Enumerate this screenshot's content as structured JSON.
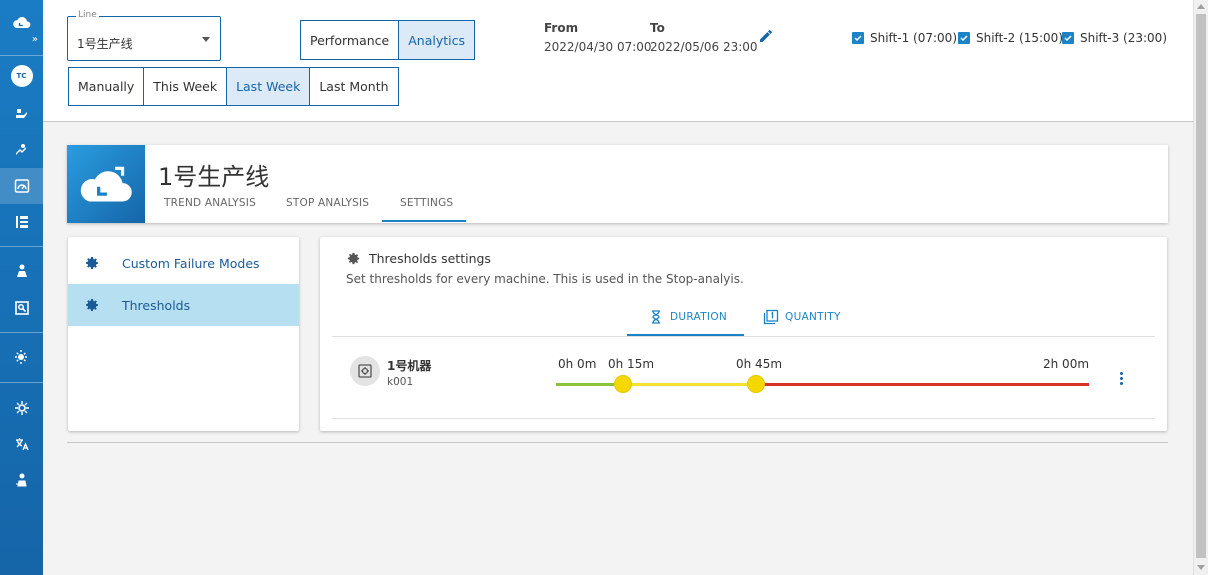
{
  "sidenav": {
    "avatar": "TC",
    "icons": [
      "cloud-logo-icon",
      "expand-icon",
      "avatar",
      "performance-icon",
      "maintenance-icon",
      "analytics-icon",
      "dashboard-icon",
      "people-icon",
      "report-icon",
      "alerts-icon",
      "settings-icon",
      "translate-icon",
      "user-icon"
    ]
  },
  "filters": {
    "line_label": "Line",
    "line_value": "1号生产线",
    "view_toggle": [
      "Performance",
      "Analytics"
    ],
    "view_active": "Analytics",
    "range_buttons": [
      "Manually",
      "This Week",
      "Last Week",
      "Last Month"
    ],
    "range_active": "Last Week",
    "from_label": "From",
    "from_value": "2022/04/30 07:00",
    "to_label": "To",
    "to_value": "2022/05/06 23:00",
    "shifts": [
      {
        "label": "Shift-1 (07:00)",
        "checked": true
      },
      {
        "label": "Shift-2 (15:00)",
        "checked": true
      },
      {
        "label": "Shift-3 (23:00)",
        "checked": true
      }
    ]
  },
  "header": {
    "title": "1号生产线",
    "tabs": [
      "TREND ANALYSIS",
      "STOP ANALYSIS",
      "SETTINGS"
    ],
    "active_tab": "SETTINGS"
  },
  "settings_menu": {
    "items": [
      "Custom Failure Modes",
      "Thresholds"
    ],
    "active": "Thresholds"
  },
  "thresholds": {
    "title": "Thresholds settings",
    "description": "Set thresholds for every machine. This is used in the Stop-analyis.",
    "tabs": [
      "DURATION",
      "QUANTITY"
    ],
    "active_tab": "DURATION",
    "machine": {
      "name": "1号机器",
      "id": "k001",
      "ticks": [
        "0h 0m",
        "0h 15m",
        "0h 45m",
        "2h 00m"
      ],
      "threshold_minutes": [
        15,
        45
      ],
      "max_minutes": 120
    },
    "colors": {
      "green": "#8ac33a",
      "yellow": "#f5e22a",
      "red": "#d6312a",
      "knob": "#f5d800"
    }
  },
  "colors": {
    "primary": "#1565a8",
    "accent": "#1c84c6",
    "active_menu": "#b7dff2"
  }
}
